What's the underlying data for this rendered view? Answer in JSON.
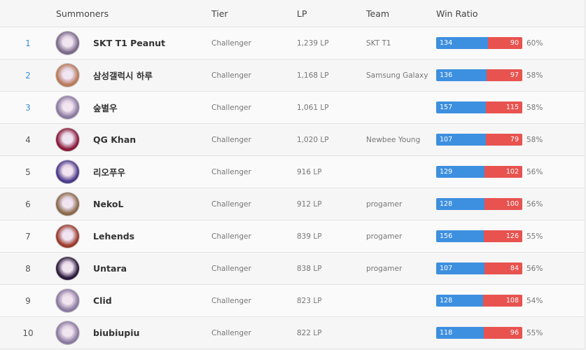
{
  "header": {
    "summoners": "Summoners",
    "tier": "Tier",
    "lp": "LP",
    "team": "Team",
    "win_ratio": "Win Ratio"
  },
  "colors": {
    "win": "#3d8fe0",
    "loss": "#e8534f"
  },
  "rows": [
    {
      "rank": "1",
      "name": "SKT T1 Peanut",
      "tier": "Challenger",
      "lp": "1,239 LP",
      "team": "SKT T1",
      "wins": "134",
      "losses": "90",
      "ratio": "60%",
      "avatar_color": "#7a6a8a"
    },
    {
      "rank": "2",
      "name": "삼성갤럭시 하루",
      "tier": "Challenger",
      "lp": "1,168 LP",
      "team": "Samsung Galaxy",
      "wins": "136",
      "losses": "97",
      "ratio": "58%",
      "avatar_color": "#b87a5a"
    },
    {
      "rank": "3",
      "name": "숲별우",
      "tier": "Challenger",
      "lp": "1,061 LP",
      "team": "",
      "wins": "157",
      "losses": "115",
      "ratio": "58%",
      "avatar_color": "#8a7aa0"
    },
    {
      "rank": "4",
      "name": "QG Khan",
      "tier": "Challenger",
      "lp": "1,020 LP",
      "team": "Newbee Young",
      "wins": "107",
      "losses": "79",
      "ratio": "58%",
      "avatar_color": "#8a1a3a"
    },
    {
      "rank": "5",
      "name": "리오푸우",
      "tier": "Challenger",
      "lp": "916 LP",
      "team": "",
      "wins": "129",
      "losses": "102",
      "ratio": "56%",
      "avatar_color": "#4a3a8a"
    },
    {
      "rank": "6",
      "name": "NekoL",
      "tier": "Challenger",
      "lp": "912 LP",
      "team": "progamer",
      "wins": "128",
      "losses": "100",
      "ratio": "56%",
      "avatar_color": "#8a6a4a"
    },
    {
      "rank": "7",
      "name": "Lehends",
      "tier": "Challenger",
      "lp": "839 LP",
      "team": "progamer",
      "wins": "156",
      "losses": "126",
      "ratio": "55%",
      "avatar_color": "#9a3a2a"
    },
    {
      "rank": "8",
      "name": "Untara",
      "tier": "Challenger",
      "lp": "838 LP",
      "team": "progamer",
      "wins": "107",
      "losses": "84",
      "ratio": "56%",
      "avatar_color": "#2a1a3a"
    },
    {
      "rank": "9",
      "name": "Clid",
      "tier": "Challenger",
      "lp": "823 LP",
      "team": "",
      "wins": "128",
      "losses": "108",
      "ratio": "54%",
      "avatar_color": "#8a7aa0"
    },
    {
      "rank": "10",
      "name": "biubiupiu",
      "tier": "Challenger",
      "lp": "822 LP",
      "team": "",
      "wins": "118",
      "losses": "96",
      "ratio": "55%",
      "avatar_color": "#8a7aa0"
    }
  ]
}
